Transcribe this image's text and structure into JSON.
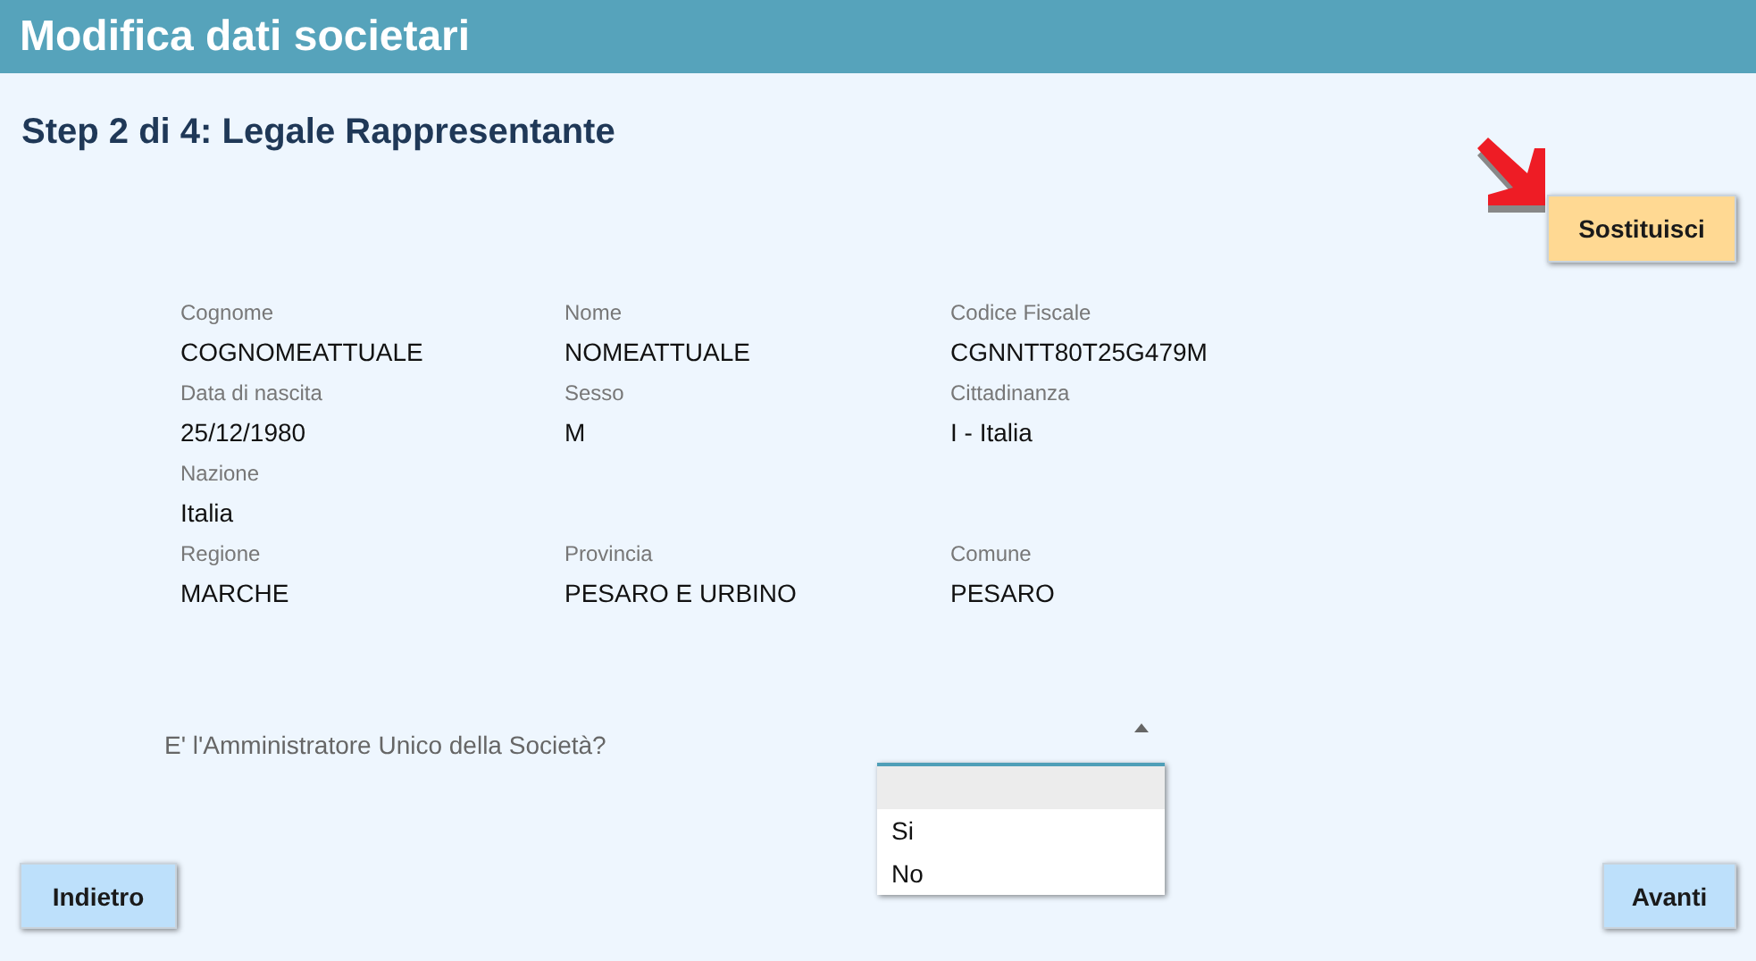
{
  "window": {
    "title": "Modifica dati societari"
  },
  "step_title": "Step 2 di 4: Legale Rappresentante",
  "replace_button": "Sostituisci",
  "field_rows": [
    {
      "fields": [
        {
          "label": "Cognome",
          "value": "COGNOMEATTUALE"
        },
        {
          "label": "Nome",
          "value": "NOMEATTUALE"
        },
        {
          "label": "Codice Fiscale",
          "value": "CGNNTT80T25G479M"
        }
      ]
    },
    {
      "fields": [
        {
          "label": "Data di nascita",
          "value": "25/12/1980"
        },
        {
          "label": "Sesso",
          "value": "M"
        },
        {
          "label": "Cittadinanza",
          "value": "I - Italia"
        }
      ]
    },
    {
      "fields": [
        {
          "label": "Nazione",
          "value": "Italia"
        }
      ]
    },
    {
      "fields": [
        {
          "label": "Regione",
          "value": "MARCHE"
        },
        {
          "label": "Provincia",
          "value": "PESARO E URBINO"
        },
        {
          "label": "Comune",
          "value": "PESARO"
        }
      ]
    }
  ],
  "question": {
    "label": "E' l'Amministratore Unico della Società?",
    "expanded": true,
    "options": [
      {
        "label": "Si",
        "selected": false
      },
      {
        "label": "No",
        "selected": false
      }
    ]
  },
  "buttons": {
    "back": "Indietro",
    "next": "Avanti"
  }
}
